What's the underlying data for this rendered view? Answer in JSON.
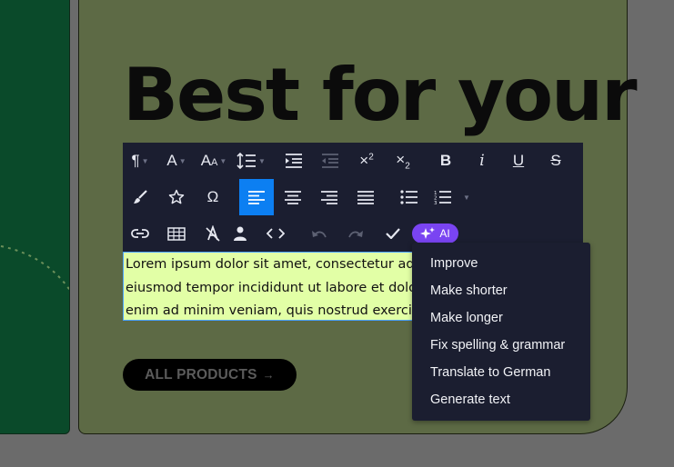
{
  "hero": {
    "title": "Best for your"
  },
  "toolbar": {
    "row1": [
      "paragraph-format",
      "font-family",
      "font-size",
      "line-height",
      "indent",
      "outdent",
      "superscript",
      "subscript",
      "bold",
      "italic",
      "underline",
      "strikethrough"
    ],
    "row2": [
      "paint-brush",
      "star",
      "special-characters",
      "align-left",
      "align-center",
      "align-right",
      "justify",
      "unordered-list",
      "ordered-list"
    ],
    "row3": [
      "link",
      "table",
      "clear-formatting",
      "user",
      "code-view",
      "undo",
      "redo",
      "check"
    ],
    "active_button": "align-left",
    "glyphs": {
      "omega": "Ω",
      "italic": "i",
      "bold": "B",
      "underline": "U",
      "strike": "S",
      "font": "A",
      "size_big": "A",
      "size_small": "A",
      "pilcrow": "¶"
    },
    "ai_label": "AI"
  },
  "editor": {
    "lines": [
      "Lorem ipsum dolor sit amet, consectetur adipiscing elit, sed do",
      "eiusmod tempor incididunt ut labore et dolore magna aliqua. Ut",
      "enim ad minim veniam, quis nostrud exercitation ullamco laboris"
    ]
  },
  "cta": {
    "label": "ALL PRODUCTS",
    "arrow": "→"
  },
  "ai_menu": {
    "items": [
      "Improve",
      "Make shorter",
      "Make longer",
      "Fix spelling & grammar",
      "Translate to German",
      "Generate text"
    ]
  },
  "colors": {
    "toolbar_bg": "#1b1e30",
    "active_blue": "#0c7ff2",
    "ai_purple": "#7a44f2",
    "editor_bg": "#e2ffa6",
    "olive": "#5d6a45",
    "green": "#0a4a2a"
  }
}
